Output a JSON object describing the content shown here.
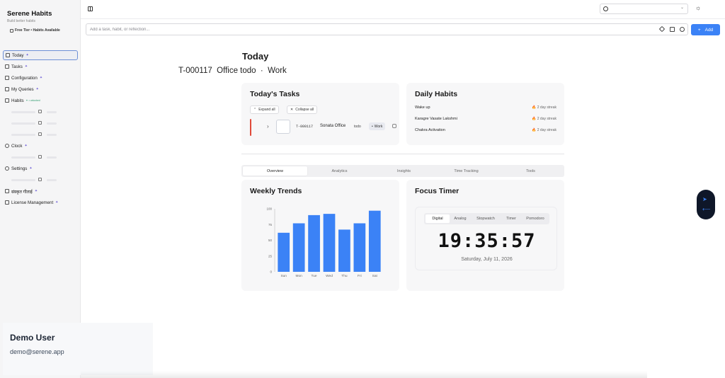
{
  "sidebar": {
    "app_title": "Serene Habits",
    "app_subtitle": "Build better habits",
    "tier": "Free Tier • Habits Available",
    "items": [
      {
        "label": "Today",
        "dot": "✦"
      },
      {
        "label": "Tasks",
        "dot": "✦"
      },
      {
        "label": "Configuration",
        "dot": "✦"
      },
      {
        "label": "My Queries",
        "dot": "✦"
      },
      {
        "label": "Habits",
        "badge": "✦ • unlocked"
      },
      {
        "label": "Clock",
        "dot": "✦"
      },
      {
        "label": "Settings",
        "dot": "✦"
      },
      {
        "label": "संस्कृत गीताई",
        "dot": "✦"
      },
      {
        "label": "License Management",
        "dot": "✦"
      }
    ]
  },
  "user": {
    "name": "Demo User",
    "email": "demo@serene.app"
  },
  "topbar": {
    "chev": "⌄",
    "theme_icon": "☼"
  },
  "quick_add": {
    "placeholder": "Add a task, habit, or reflection...",
    "add_label": "Add",
    "add_icon": "+"
  },
  "header": {
    "title": "Today",
    "subtitle": "T-000117  Office todo  ·  Work"
  },
  "tasks_card": {
    "title": "Today's Tasks",
    "expand_label": "Expand all",
    "collapse_label": "Collapse all",
    "task": {
      "chev": "›",
      "id": "T-000117",
      "name": "Sonata Office",
      "state": "todo",
      "tag": "Work"
    }
  },
  "habits_card": {
    "title": "Daily Habits",
    "flame": "🔥",
    "items": [
      {
        "name": "Wake up",
        "streak": "2 day streak"
      },
      {
        "name": "Karagre Vasate Lakshmi",
        "streak": "2 day streak"
      },
      {
        "name": "Chakra Activation",
        "streak": "2 day streak"
      }
    ]
  },
  "tabs": [
    "Overview",
    "Analytics",
    "Insights",
    "Time Tracking",
    "Tools"
  ],
  "trends_card": {
    "title": "Weekly Trends"
  },
  "timer_card": {
    "title": "Focus Timer",
    "modes": [
      "Digital",
      "Analog",
      "Stopwatch",
      "Timer",
      "Pomodoro"
    ],
    "time": "19:35:57",
    "date": "Saturday, July 11, 2026"
  },
  "float": {
    "icon1": "➤",
    "icon2": "⟵"
  },
  "colors": {
    "accent": "#3b82f6",
    "bar": "#3b82f6",
    "priority": "#e04a3a"
  },
  "chart_data": {
    "type": "bar",
    "categories": [
      "Sun",
      "Mon",
      "Tue",
      "Wed",
      "Thu",
      "Fri",
      "Sat"
    ],
    "values": [
      62,
      77,
      90,
      92,
      67,
      77,
      97
    ],
    "ylim": [
      0,
      100
    ],
    "yticks": [
      0,
      25,
      50,
      75,
      100
    ],
    "grid": false,
    "legend": "none"
  }
}
